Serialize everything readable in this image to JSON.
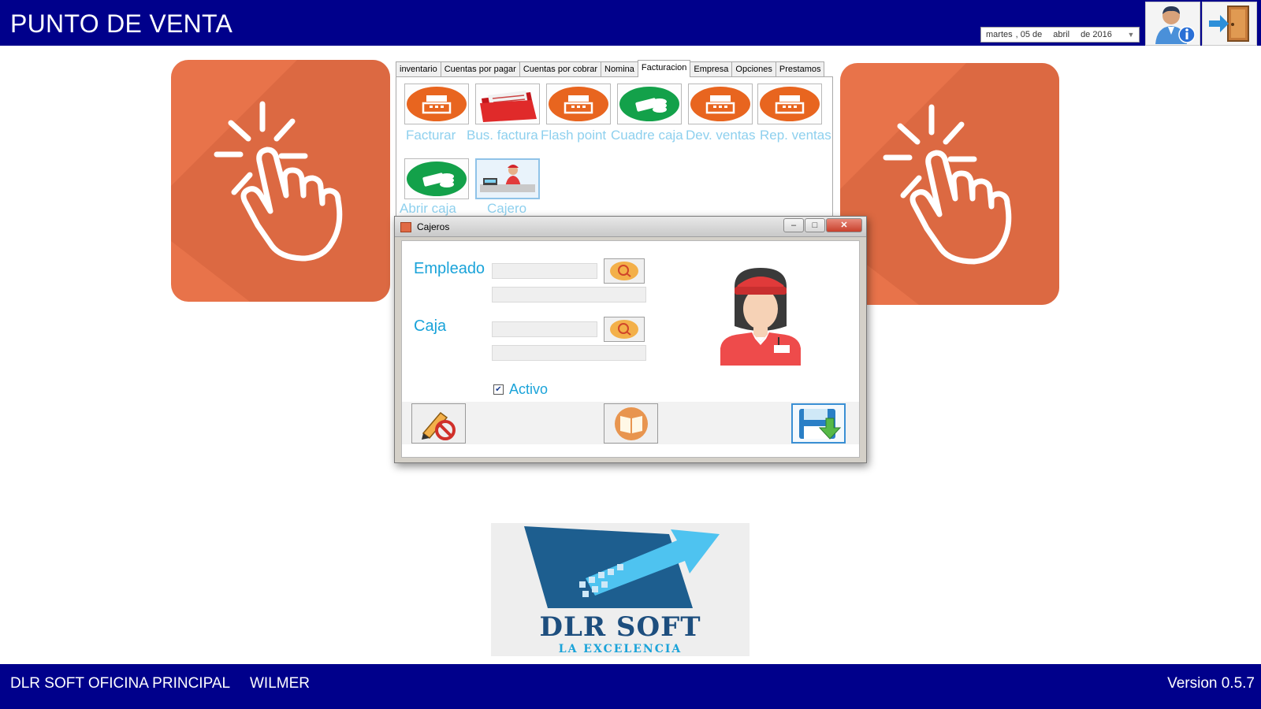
{
  "header": {
    "title": "PUNTO DE VENTA",
    "date": {
      "weekday": "martes",
      "day": ", 05 de",
      "month": "abril",
      "year": "de 2016"
    },
    "buttons": {
      "user_info": "user-info-icon",
      "exit": "exit-door-icon"
    }
  },
  "tabs": [
    {
      "label": "inventario"
    },
    {
      "label": "Cuentas por pagar"
    },
    {
      "label": "Cuentas por cobrar"
    },
    {
      "label": "Nomina"
    },
    {
      "label": "Facturacion",
      "active": true
    },
    {
      "label": "Empresa"
    },
    {
      "label": "Opciones"
    },
    {
      "label": "Prestamos"
    }
  ],
  "modules": [
    {
      "label": "Facturar",
      "icon": "cash-register-icon"
    },
    {
      "label": "Bus. factura",
      "icon": "invoice-folder-icon"
    },
    {
      "label": "Flash point",
      "icon": "cash-register-icon"
    },
    {
      "label": "Cuadre caja",
      "icon": "money-stack-icon"
    },
    {
      "label": "Dev. ventas",
      "icon": "cash-register-icon"
    },
    {
      "label": "Rep. ventas",
      "icon": "cash-register-icon"
    },
    {
      "label": "Abrir caja",
      "icon": "money-stack-icon"
    },
    {
      "label": "Cajero",
      "icon": "cashier-icon"
    }
  ],
  "dialog": {
    "title": "Cajeros",
    "fields": {
      "empleado_label": "Empleado",
      "caja_label": "Caja",
      "activo_label": "Activo",
      "activo_checked": true
    },
    "actions": [
      "cancel-edit-icon",
      "open-book-icon",
      "save-floppy-icon"
    ]
  },
  "logo": {
    "name": "DLR SOFT",
    "tagline": "LA EXCELENCIA"
  },
  "footer": {
    "branch": "DLR SOFT OFICINA PRINCIPAL",
    "user": "WILMER",
    "version": "Version 0.5.7"
  },
  "colors": {
    "bar": "#00008b",
    "tile": "#e8734a",
    "accent_text": "#1aa3d9"
  }
}
